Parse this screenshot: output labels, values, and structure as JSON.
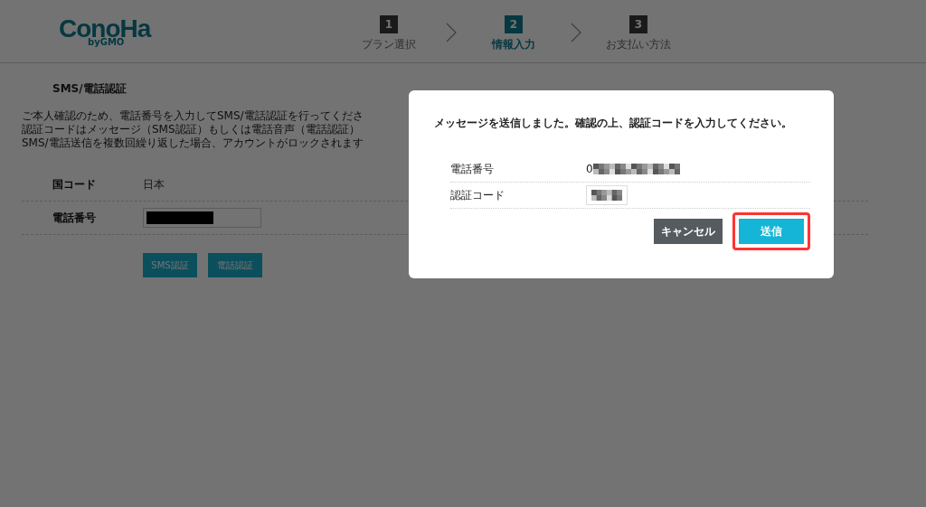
{
  "header": {
    "logo": "ConoHa",
    "logo_sub": "byGMO",
    "steps": [
      {
        "number": "1",
        "label": "プラン選択",
        "selected": false
      },
      {
        "number": "2",
        "label": "情報入力",
        "selected": true
      },
      {
        "number": "3",
        "label": "お支払い方法",
        "selected": false
      }
    ]
  },
  "section": {
    "title": "SMS/電話認証",
    "description": [
      "ご本人確認のため、電話番号を入力してSMS/電話認証を行ってくださ",
      "認証コードはメッセージ（SMS認証）もしくは電話音声（電話認証）",
      "SMS/電話送信を複数回繰り返した場合、アカウントがロックされます"
    ],
    "fields": [
      {
        "kind": "text",
        "label": "国コード",
        "value": "日本"
      },
      {
        "kind": "masked",
        "label": "電話番号"
      }
    ],
    "buttons": [
      "SMS認証",
      "電話認証"
    ]
  },
  "dialog": {
    "message": "メッセージを送信しました。確認の上、認証コードを入力してください。",
    "fields": [
      {
        "kind": "text",
        "label": "電話番号",
        "value": "0"
      },
      {
        "kind": "input",
        "label": "認証コード"
      }
    ],
    "buttons": [
      {
        "label": "キャンセル",
        "kind": "secondary",
        "highlighted": false
      },
      {
        "label": "送信",
        "kind": "primary",
        "highlighted": true
      }
    ]
  }
}
